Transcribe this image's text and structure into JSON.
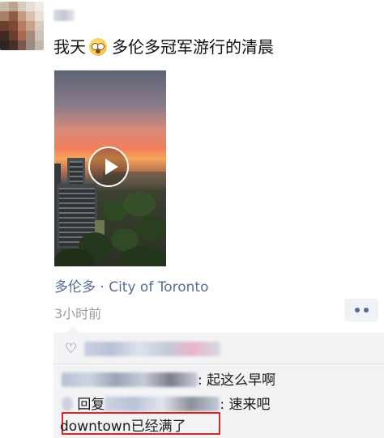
{
  "post": {
    "text_before": "我天",
    "emoji": "astonished-face",
    "text_after": "多伦多冠军游行的清晨",
    "location": "多伦多 · City of Toronto",
    "time": "3小时前"
  },
  "video": {
    "play_icon": "play-icon"
  },
  "comments": [
    {
      "sep": ": ",
      "text": "起这么早啊"
    },
    {
      "prefix": "回复",
      "sep": ": ",
      "text": "速来吧"
    },
    {
      "text": "downtown已经满了"
    }
  ],
  "colors": {
    "link": "#576b95",
    "highlight": "#e02525",
    "comment_bg": "#f3f3f5"
  }
}
